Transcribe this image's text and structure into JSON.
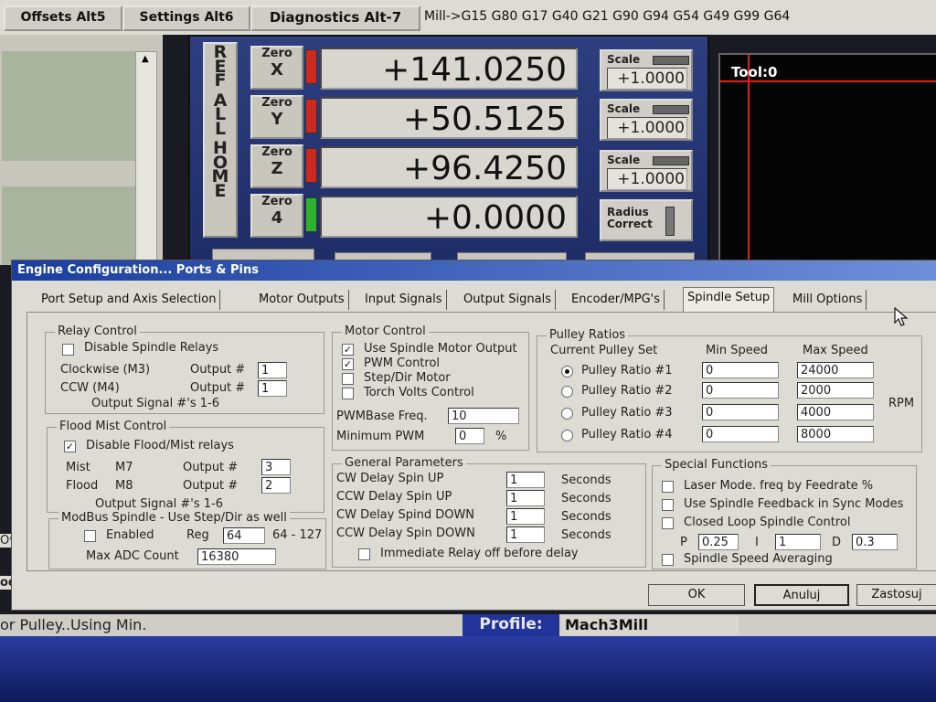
{
  "top_tabs": [
    {
      "label": "Offsets Alt5"
    },
    {
      "label": "Settings Alt6"
    },
    {
      "label": "Diagnostics Alt-7"
    }
  ],
  "gcode_line": "Mill->G15  G80 G17 G40 G21 G90 G94 G54 G49 G99 G64",
  "ref_all_home": "REF ALL HOME",
  "axes": [
    {
      "zero": "Zero",
      "axis": "X",
      "value": "+141.0250",
      "scale_label": "Scale",
      "scale": "+1.0000",
      "led": "#cc2a1f"
    },
    {
      "zero": "Zero",
      "axis": "Y",
      "value": "+50.5125",
      "scale_label": "Scale",
      "scale": "+1.0000",
      "led": "#cc2a1f"
    },
    {
      "zero": "Zero",
      "axis": "Z",
      "value": "+96.4250",
      "scale_label": "Scale",
      "scale": "+1.0000",
      "led": "#cc2a1f"
    },
    {
      "zero": "Zero",
      "axis": "4",
      "value": "+0.0000",
      "radius_label": "Radius Correct",
      "led": "#2db32d"
    }
  ],
  "tool_label": "Tool:0",
  "dialog": {
    "title": "Engine Configuration... Ports & Pins",
    "tabs": [
      {
        "label": "Port Setup and Axis Selection"
      },
      {
        "label": "Motor Outputs"
      },
      {
        "label": "Input Signals"
      },
      {
        "label": "Output Signals"
      },
      {
        "label": "Encoder/MPG's"
      },
      {
        "label": "Spindle Setup"
      },
      {
        "label": "Mill Options"
      }
    ],
    "relay_control": {
      "legend": "Relay Control",
      "disable_label": "Disable Spindle Relays",
      "cw_label": "Clockwise (M3)",
      "ccw_label": "CCW (M4)",
      "output_label": "Output #",
      "cw_value": "1",
      "ccw_value": "1",
      "note": "Output Signal #'s 1-6"
    },
    "flood_mist": {
      "legend": "Flood Mist Control",
      "disable_label": "Disable Flood/Mist relays",
      "mist_label": "Mist",
      "mist_code": "M7",
      "flood_label": "Flood",
      "flood_code": "M8",
      "output_label": "Output #",
      "mist_value": "3",
      "flood_value": "2",
      "note": "Output Signal #'s 1-6"
    },
    "modbus": {
      "legend": "ModBus Spindle - Use Step/Dir as well",
      "enabled_label": "Enabled",
      "reg_label": "Reg",
      "reg_value": "64",
      "reg_range": "64 - 127",
      "max_adc_label": "Max ADC Count",
      "max_adc_value": "16380"
    },
    "motor_control": {
      "legend": "Motor Control",
      "use_spindle": "Use Spindle Motor Output",
      "pwm_control": "PWM Control",
      "step_dir": "Step/Dir Motor",
      "torch": "Torch Volts Control",
      "pwm_freq_label": "PWMBase Freq.",
      "pwm_freq_value": "10",
      "min_pwm_label": "Minimum PWM",
      "min_pwm_value": "0",
      "percent": "%"
    },
    "general": {
      "legend": "General Parameters",
      "rows": [
        {
          "label": "CW Delay Spin UP",
          "value": "1",
          "unit": "Seconds"
        },
        {
          "label": "CCW Delay Spin UP",
          "value": "1",
          "unit": "Seconds"
        },
        {
          "label": "CW Delay Spind DOWN",
          "value": "1",
          "unit": "Seconds"
        },
        {
          "label": "CCW Delay Spin DOWN",
          "value": "1",
          "unit": "Seconds"
        }
      ],
      "immediate_label": "Immediate Relay off before delay"
    },
    "pulley": {
      "legend": "Pulley Ratios",
      "current_label": "Current Pulley Set",
      "min_header": "Min Speed",
      "max_header": "Max Speed",
      "rpm": "RPM",
      "rows": [
        {
          "label": "Pulley Ratio #1",
          "min": "0",
          "max": "24000"
        },
        {
          "label": "Pulley Ratio #2",
          "min": "0",
          "max": "2000"
        },
        {
          "label": "Pulley Ratio #3",
          "min": "0",
          "max": "4000"
        },
        {
          "label": "Pulley Ratio #4",
          "min": "0",
          "max": "8000"
        }
      ]
    },
    "special": {
      "legend": "Special Functions",
      "laser": "Laser Mode. freq by Feedrate %",
      "feedback": "Use Spindle Feedback in Sync Modes",
      "closed_loop": "Closed Loop Spindle Control",
      "p_label": "P",
      "p_value": "0.25",
      "i_label": "I",
      "i_value": "1",
      "d_label": "D",
      "d_value": "0.3",
      "averaging": "Spindle Speed Averaging"
    },
    "ok_label": "OK",
    "cancel_label": "Anuluj",
    "apply_label": "Zastosuj"
  },
  "status_text": "or Pulley..Using Min.",
  "profile_label": "Profile:",
  "profile_value": "Mach3Mill",
  "left_edge_labels": [
    "Ov",
    "od"
  ]
}
